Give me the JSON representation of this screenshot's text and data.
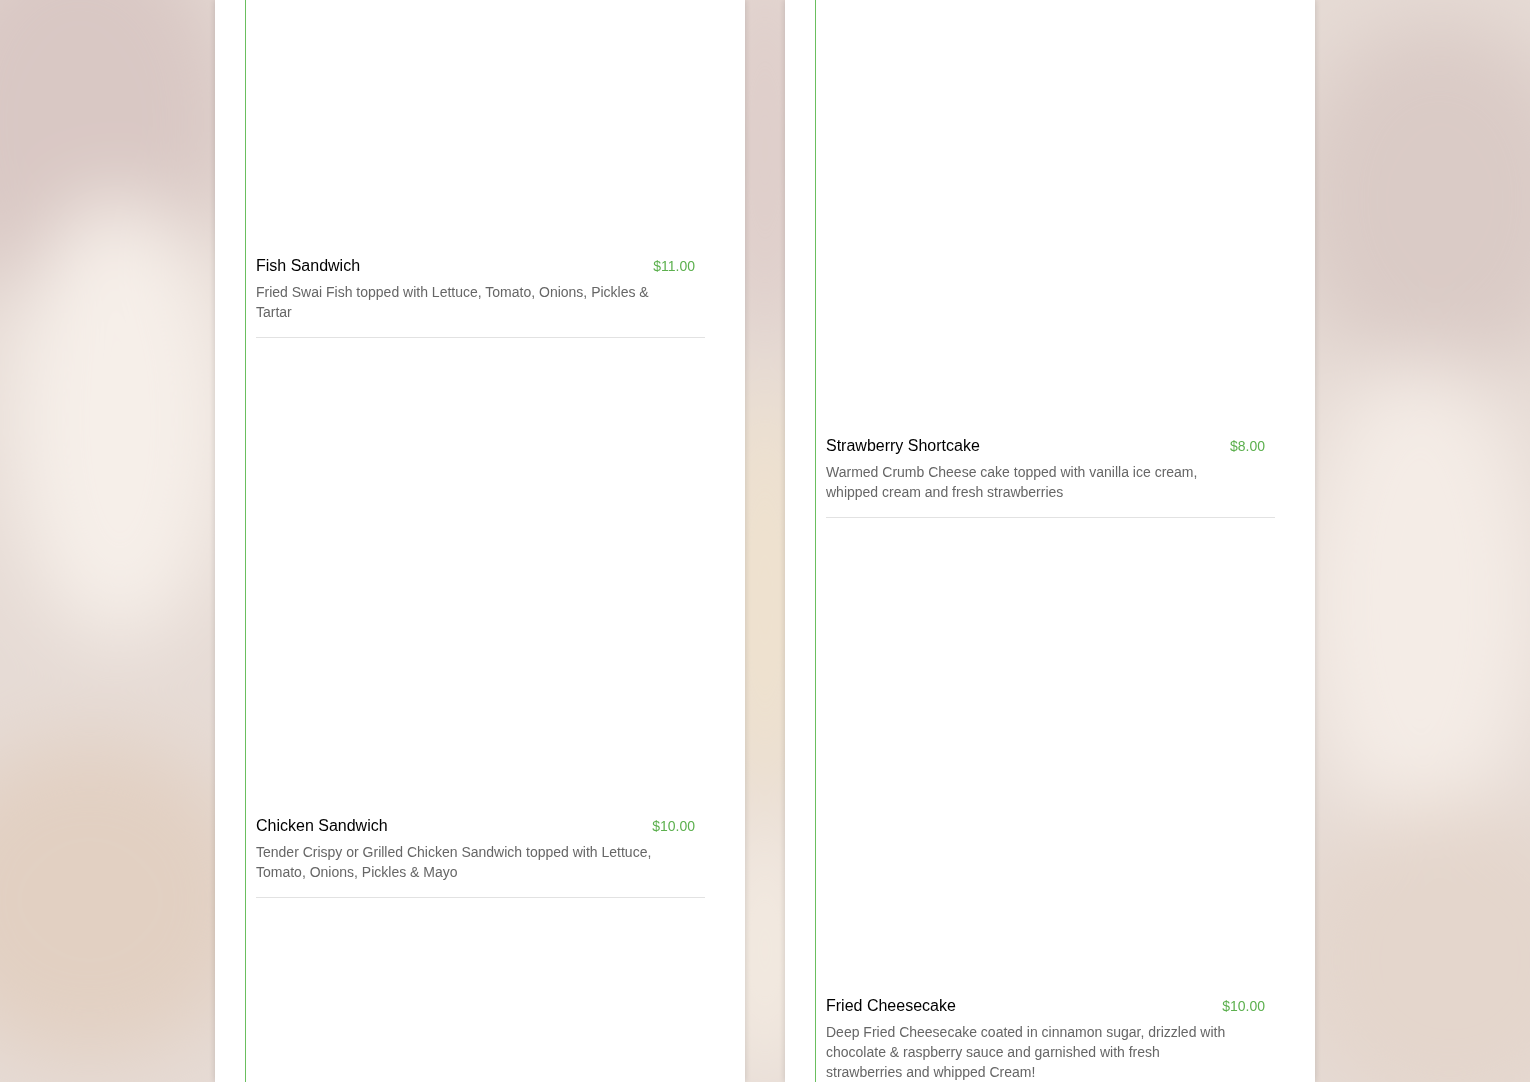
{
  "columns": [
    {
      "items": [
        {
          "name": "Fish Sandwich",
          "price": "$11.00",
          "description": "Fried Swai Fish topped with Lettuce, Tomato, Onions, Pickles & Tartar"
        },
        {
          "name": "Chicken Sandwich",
          "price": "$10.00",
          "description": "Tender Crispy or Grilled Chicken Sandwich topped with Lettuce, Tomato, Onions, Pickles & Mayo"
        }
      ]
    },
    {
      "items": [
        {
          "name": "Strawberry Shortcake",
          "price": "$8.00",
          "description": "Warmed Crumb Cheese cake topped with vanilla ice cream, whipped cream and fresh strawberries"
        },
        {
          "name": "Fried Cheesecake",
          "price": "$10.00",
          "description": "Deep Fried Cheesecake coated in cinnamon sugar, drizzled with chocolate & raspberry sauce and garnished with fresh strawberries and whipped Cream!"
        }
      ]
    }
  ]
}
